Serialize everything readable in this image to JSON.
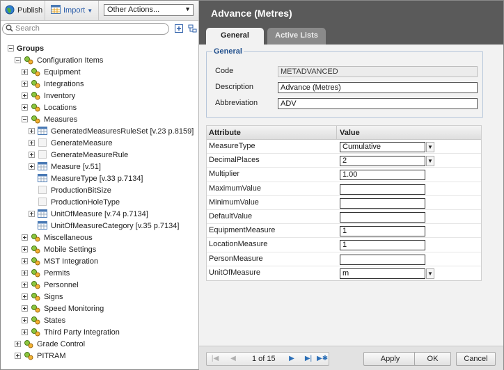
{
  "toolbar": {
    "publish_label": "Publish",
    "import_label": "Import",
    "other_actions": "Other Actions..."
  },
  "search": {
    "placeholder": "Search"
  },
  "tree": {
    "groups": "Groups",
    "configuration_items": "Configuration Items",
    "equipment": "Equipment",
    "integrations": "Integrations",
    "inventory": "Inventory",
    "locations": "Locations",
    "measures": "Measures",
    "generated_measures_ruleset": "GeneratedMeasuresRuleSet [v.23 p.8159]",
    "generate_measure": "GenerateMeasure",
    "generate_measure_rule": "GenerateMeasureRule",
    "measure": "Measure [v.51]",
    "measure_type": "MeasureType [v.33 p.7134]",
    "production_bit_size": "ProductionBitSize",
    "production_hole_type": "ProductionHoleType",
    "unit_of_measure": "UnitOfMeasure [v.74 p.7134]",
    "unit_of_measure_category": "UnitOfMeasureCategory [v.35 p.7134]",
    "miscellaneous": "Miscellaneous",
    "mobile_settings": "Mobile Settings",
    "mst_integration": "MST Integration",
    "permits": "Permits",
    "personnel": "Personnel",
    "signs": "Signs",
    "speed_monitoring": "Speed Monitoring",
    "states": "States",
    "third_party_integration": "Third Party Integration",
    "grade_control": "Grade Control",
    "pitram": "PITRAM"
  },
  "detail": {
    "title": "Advance (Metres)",
    "tabs": {
      "general": "General",
      "active_lists": "Active Lists"
    },
    "general_legend": "General",
    "fields": {
      "code_label": "Code",
      "code_value": "METADVANCED",
      "description_label": "Description",
      "description_value": "Advance (Metres)",
      "abbreviation_label": "Abbreviation",
      "abbreviation_value": "ADV"
    },
    "table": {
      "col_attribute": "Attribute",
      "col_value": "Value",
      "rows": [
        {
          "name": "MeasureType",
          "value": "Cumulative"
        },
        {
          "name": "DecimalPlaces",
          "value": "2"
        },
        {
          "name": "Multiplier",
          "value": "1.00"
        },
        {
          "name": "MaximumValue",
          "value": ""
        },
        {
          "name": "MinimumValue",
          "value": ""
        },
        {
          "name": "DefaultValue",
          "value": ""
        },
        {
          "name": "EquipmentMeasure",
          "value": "1"
        },
        {
          "name": "LocationMeasure",
          "value": "1"
        },
        {
          "name": "PersonMeasure",
          "value": ""
        },
        {
          "name": "UnitOfMeasure",
          "value": "m"
        }
      ]
    }
  },
  "footer": {
    "pager_text": "1 of 15",
    "apply_label": "Apply",
    "ok_label": "OK",
    "cancel_label": "Cancel"
  },
  "colors": {
    "title_bar": "#5a5a5a",
    "legend_blue": "#1f4e8c",
    "pane_background": "#f2f2f2"
  }
}
